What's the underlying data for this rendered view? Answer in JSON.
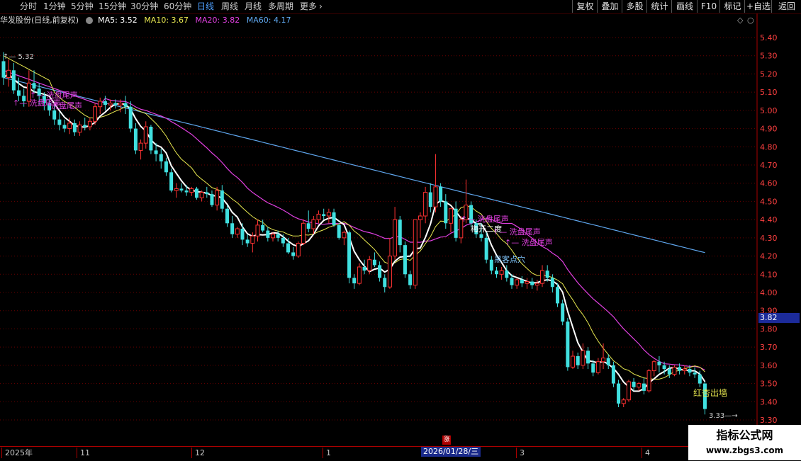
{
  "toolbar": {
    "periods": [
      "分时",
      "1分钟",
      "5分钟",
      "15分钟",
      "30分钟",
      "60分钟",
      "日线",
      "周线",
      "月线",
      "多周期",
      "更多"
    ],
    "active_period": "日线",
    "right_buttons": [
      "复权",
      "叠加",
      "多股",
      "统计",
      "画线",
      "F10",
      "标记",
      "+自选",
      "返回"
    ]
  },
  "info": {
    "stock": "华发股份(日线,前复权)",
    "ma5": "MA5: 3.52",
    "ma10": "MA10: 3.67",
    "ma20": "MA20: 3.82",
    "ma60": "MA60: 4.17"
  },
  "colors": {
    "up": "#ff3232",
    "down": "#40e0e0",
    "ma5": "#ffffff",
    "ma10": "#e8e850",
    "ma20": "#e040e0",
    "ma60": "#60a8f0",
    "grid": "#6a0000"
  },
  "chart_data": {
    "type": "candlestick",
    "ylim": [
      3.27,
      5.48
    ],
    "y_ticks": [
      "5.40",
      "5.30",
      "5.20",
      "5.10",
      "5.00",
      "4.90",
      "4.80",
      "4.70",
      "4.60",
      "4.50",
      "4.40",
      "4.30",
      "4.20",
      "4.10",
      "4.00",
      "3.90",
      "3.80",
      "3.70",
      "3.60",
      "3.50",
      "3.40",
      "3.30"
    ],
    "candles": [
      [
        5.27,
        5.32,
        5.14,
        5.18
      ],
      [
        5.18,
        5.28,
        5.13,
        5.22
      ],
      [
        5.22,
        5.26,
        5.09,
        5.11
      ],
      [
        5.11,
        5.18,
        5.05,
        5.08
      ],
      [
        5.08,
        5.12,
        5.02,
        5.05
      ],
      [
        5.05,
        5.22,
        5.02,
        5.15
      ],
      [
        5.15,
        5.22,
        5.1,
        5.12
      ],
      [
        5.12,
        5.15,
        5.03,
        5.08
      ],
      [
        5.08,
        5.1,
        5.0,
        5.04
      ],
      [
        5.04,
        5.06,
        4.97,
        5.0
      ],
      [
        5.0,
        5.03,
        4.92,
        4.95
      ],
      [
        4.95,
        4.99,
        4.89,
        4.92
      ],
      [
        4.92,
        4.95,
        4.88,
        4.9
      ],
      [
        4.9,
        4.96,
        4.87,
        4.93
      ],
      [
        4.93,
        4.95,
        4.86,
        4.88
      ],
      [
        4.88,
        4.94,
        4.86,
        4.92
      ],
      [
        4.92,
        4.96,
        4.89,
        4.91
      ],
      [
        4.91,
        4.96,
        4.89,
        4.94
      ],
      [
        4.94,
        5.04,
        4.92,
        5.02
      ],
      [
        5.02,
        5.07,
        4.98,
        5.05
      ],
      [
        5.05,
        5.08,
        5.0,
        5.03
      ],
      [
        5.03,
        5.06,
        5.0,
        5.04
      ],
      [
        5.04,
        5.06,
        5.01,
        5.03
      ],
      [
        5.03,
        5.06,
        4.99,
        5.04
      ],
      [
        5.04,
        5.08,
        4.98,
        5.02
      ],
      [
        5.02,
        5.05,
        4.88,
        4.9
      ],
      [
        4.9,
        4.93,
        4.76,
        4.78
      ],
      [
        4.78,
        4.84,
        4.73,
        4.82
      ],
      [
        4.82,
        4.94,
        4.79,
        4.91
      ],
      [
        4.91,
        4.92,
        4.76,
        4.78
      ],
      [
        4.78,
        4.82,
        4.72,
        4.76
      ],
      [
        4.76,
        4.79,
        4.68,
        4.72
      ],
      [
        4.72,
        4.74,
        4.64,
        4.66
      ],
      [
        4.66,
        4.68,
        4.55,
        4.56
      ],
      [
        4.56,
        4.6,
        4.52,
        4.57
      ],
      [
        4.57,
        4.6,
        4.55,
        4.56
      ],
      [
        4.56,
        4.59,
        4.53,
        4.55
      ],
      [
        4.55,
        4.58,
        4.53,
        4.57
      ],
      [
        4.57,
        4.58,
        4.51,
        4.52
      ],
      [
        4.52,
        4.56,
        4.5,
        4.55
      ],
      [
        4.55,
        4.58,
        4.52,
        4.54
      ],
      [
        4.54,
        4.56,
        4.47,
        4.48
      ],
      [
        4.48,
        4.58,
        4.45,
        4.56
      ],
      [
        4.56,
        4.59,
        4.44,
        4.46
      ],
      [
        4.46,
        4.48,
        4.36,
        4.38
      ],
      [
        4.38,
        4.42,
        4.3,
        4.32
      ],
      [
        4.32,
        4.36,
        4.3,
        4.35
      ],
      [
        4.35,
        4.38,
        4.26,
        4.29
      ],
      [
        4.29,
        4.32,
        4.25,
        4.27
      ],
      [
        4.27,
        4.33,
        4.22,
        4.31
      ],
      [
        4.31,
        4.4,
        4.28,
        4.37
      ],
      [
        4.37,
        4.4,
        4.33,
        4.34
      ],
      [
        4.34,
        4.36,
        4.28,
        4.3
      ],
      [
        4.3,
        4.33,
        4.28,
        4.32
      ],
      [
        4.32,
        4.34,
        4.28,
        4.3
      ],
      [
        4.3,
        4.32,
        4.25,
        4.27
      ],
      [
        4.27,
        4.3,
        4.21,
        4.22
      ],
      [
        4.22,
        4.25,
        4.18,
        4.2
      ],
      [
        4.2,
        4.28,
        4.19,
        4.27
      ],
      [
        4.27,
        4.4,
        4.26,
        4.38
      ],
      [
        4.38,
        4.45,
        4.33,
        4.35
      ],
      [
        4.35,
        4.42,
        4.32,
        4.4
      ],
      [
        4.4,
        4.45,
        4.38,
        4.43
      ],
      [
        4.43,
        4.46,
        4.4,
        4.42
      ],
      [
        4.42,
        4.46,
        4.38,
        4.44
      ],
      [
        4.44,
        4.46,
        4.36,
        4.37
      ],
      [
        4.37,
        4.38,
        4.29,
        4.3
      ],
      [
        4.3,
        4.34,
        4.26,
        4.33
      ],
      [
        4.33,
        4.34,
        4.05,
        4.08
      ],
      [
        4.08,
        4.1,
        4.02,
        4.05
      ],
      [
        4.05,
        4.16,
        4.04,
        4.14
      ],
      [
        4.14,
        4.18,
        4.1,
        4.12
      ],
      [
        4.12,
        4.2,
        4.1,
        4.18
      ],
      [
        4.18,
        4.22,
        4.14,
        4.15
      ],
      [
        4.15,
        4.17,
        4.06,
        4.08
      ],
      [
        4.08,
        4.1,
        4.0,
        4.03
      ],
      [
        4.03,
        4.3,
        4.02,
        4.2
      ],
      [
        4.2,
        4.47,
        4.18,
        4.4
      ],
      [
        4.4,
        4.42,
        4.22,
        4.26
      ],
      [
        4.26,
        4.28,
        4.08,
        4.1
      ],
      [
        4.1,
        4.12,
        4.02,
        4.04
      ],
      [
        4.04,
        4.3,
        4.02,
        4.4
      ],
      [
        4.4,
        4.44,
        4.3,
        4.42
      ],
      [
        4.42,
        4.58,
        4.38,
        4.55
      ],
      [
        4.55,
        4.6,
        4.44,
        4.47
      ],
      [
        4.47,
        4.76,
        4.44,
        4.58
      ],
      [
        4.58,
        4.6,
        4.47,
        4.5
      ],
      [
        4.5,
        4.54,
        4.35,
        4.38
      ],
      [
        4.38,
        4.42,
        4.33,
        4.46
      ],
      [
        4.46,
        4.5,
        4.28,
        4.3
      ],
      [
        4.3,
        4.42,
        4.27,
        4.4
      ],
      [
        4.4,
        4.62,
        4.38,
        4.48
      ],
      [
        4.48,
        4.5,
        4.36,
        4.38
      ],
      [
        4.38,
        4.4,
        4.3,
        4.32
      ],
      [
        4.32,
        4.38,
        4.28,
        4.3
      ],
      [
        4.3,
        4.33,
        4.16,
        4.18
      ],
      [
        4.18,
        4.2,
        4.1,
        4.12
      ],
      [
        4.12,
        4.14,
        4.08,
        4.1
      ],
      [
        4.1,
        4.14,
        4.07,
        4.12
      ],
      [
        4.12,
        4.15,
        4.06,
        4.08
      ],
      [
        4.08,
        4.1,
        4.02,
        4.04
      ],
      [
        4.04,
        4.08,
        4.02,
        4.07
      ],
      [
        4.07,
        4.09,
        4.03,
        4.05
      ],
      [
        4.05,
        4.08,
        4.02,
        4.06
      ],
      [
        4.06,
        4.08,
        4.02,
        4.04
      ],
      [
        4.04,
        4.07,
        4.01,
        4.05
      ],
      [
        4.05,
        4.15,
        4.03,
        4.12
      ],
      [
        4.12,
        4.15,
        4.06,
        4.08
      ],
      [
        4.08,
        4.1,
        4.0,
        4.03
      ],
      [
        4.03,
        4.05,
        3.92,
        3.94
      ],
      [
        3.94,
        3.96,
        3.82,
        3.84
      ],
      [
        3.84,
        3.86,
        3.57,
        3.59
      ],
      [
        3.59,
        3.68,
        3.58,
        3.65
      ],
      [
        3.65,
        3.67,
        3.58,
        3.6
      ],
      [
        3.6,
        3.72,
        3.58,
        3.68
      ],
      [
        3.68,
        3.7,
        3.58,
        3.61
      ],
      [
        3.61,
        3.63,
        3.54,
        3.56
      ],
      [
        3.56,
        3.64,
        3.55,
        3.62
      ],
      [
        3.62,
        3.72,
        3.58,
        3.64
      ],
      [
        3.64,
        3.66,
        3.58,
        3.6
      ],
      [
        3.6,
        3.62,
        3.48,
        3.5
      ],
      [
        3.5,
        3.52,
        3.37,
        3.39
      ],
      [
        3.39,
        3.42,
        3.37,
        3.41
      ],
      [
        3.41,
        3.52,
        3.4,
        3.51
      ],
      [
        3.51,
        3.53,
        3.46,
        3.48
      ],
      [
        3.48,
        3.51,
        3.46,
        3.5
      ],
      [
        3.5,
        3.53,
        3.44,
        3.46
      ],
      [
        3.46,
        3.58,
        3.45,
        3.57
      ],
      [
        3.57,
        3.63,
        3.54,
        3.62
      ],
      [
        3.62,
        3.65,
        3.56,
        3.6
      ],
      [
        3.6,
        3.62,
        3.55,
        3.58
      ],
      [
        3.58,
        3.6,
        3.53,
        3.55
      ],
      [
        3.55,
        3.6,
        3.54,
        3.59
      ],
      [
        3.59,
        3.61,
        3.55,
        3.57
      ],
      [
        3.57,
        3.6,
        3.55,
        3.58
      ],
      [
        3.58,
        3.6,
        3.54,
        3.56
      ],
      [
        3.56,
        3.59,
        3.53,
        3.55
      ],
      [
        3.55,
        3.57,
        3.48,
        3.5
      ],
      [
        3.5,
        3.51,
        3.33,
        3.36
      ]
    ],
    "labels": {
      "high": "5.32",
      "low": "3.33",
      "signal1a": "洗盘尾声",
      "signal1b": "洗盘尾声",
      "signal1c": "洗盘尾声",
      "signal2": "洗盘尾声",
      "signal3": "洗盘尾声",
      "signal4": "洗盘尾声",
      "signal5": "梅开二度",
      "signal6": "黑客点穴",
      "signal7": "红杏出墙"
    }
  },
  "axis": {
    "current_price": "3.82",
    "dates": [
      {
        "label": "2025年",
        "x": 2
      },
      {
        "label": "11",
        "x": 108
      },
      {
        "label": "12",
        "x": 270
      },
      {
        "label": "1",
        "x": 455
      },
      {
        "label": "3",
        "x": 728
      },
      {
        "label": "4",
        "x": 905
      }
    ],
    "cursor_date": "2026/01/28/三",
    "zhang": "涨"
  },
  "watermark": {
    "title": "指标公式网",
    "url": "www.zbgs3.com"
  }
}
